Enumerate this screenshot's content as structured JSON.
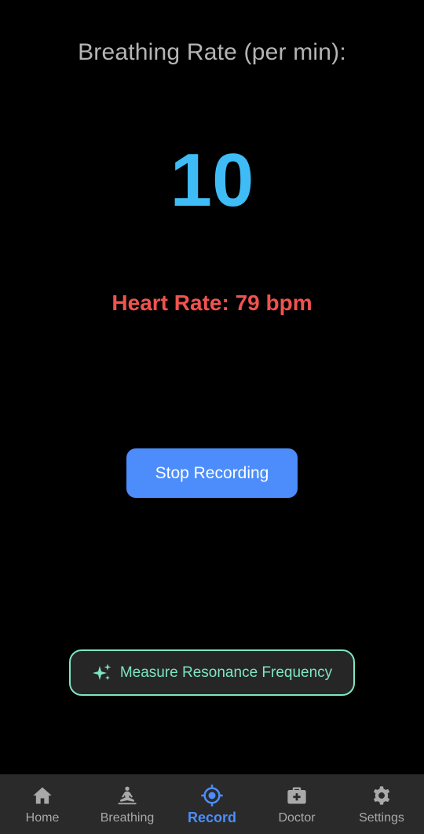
{
  "colors": {
    "background": "#000000",
    "breath_value": "#3fbcf5",
    "heart_rate": "#f0534e",
    "primary_button": "#4c8dfb",
    "accent_teal": "#7de6c4",
    "nav_active": "#4c8dfb",
    "nav_inactive": "#a9a9a9"
  },
  "main": {
    "breathing_label": "Breathing Rate (per min):",
    "breathing_value": "10",
    "heart_rate_text": "Heart Rate: 79 bpm",
    "stop_button_label": "Stop Recording",
    "resonance_button": {
      "icon": "sparkle-icon",
      "label": "Measure Resonance Frequency"
    }
  },
  "nav": {
    "active": "record",
    "items": [
      {
        "id": "home",
        "label": "Home",
        "icon": "home-icon"
      },
      {
        "id": "breathing",
        "label": "Breathing",
        "icon": "meditation-icon"
      },
      {
        "id": "record",
        "label": "Record",
        "icon": "target-icon"
      },
      {
        "id": "doctor",
        "label": "Doctor",
        "icon": "medical-kit-icon"
      },
      {
        "id": "settings",
        "label": "Settings",
        "icon": "gear-icon"
      }
    ]
  }
}
